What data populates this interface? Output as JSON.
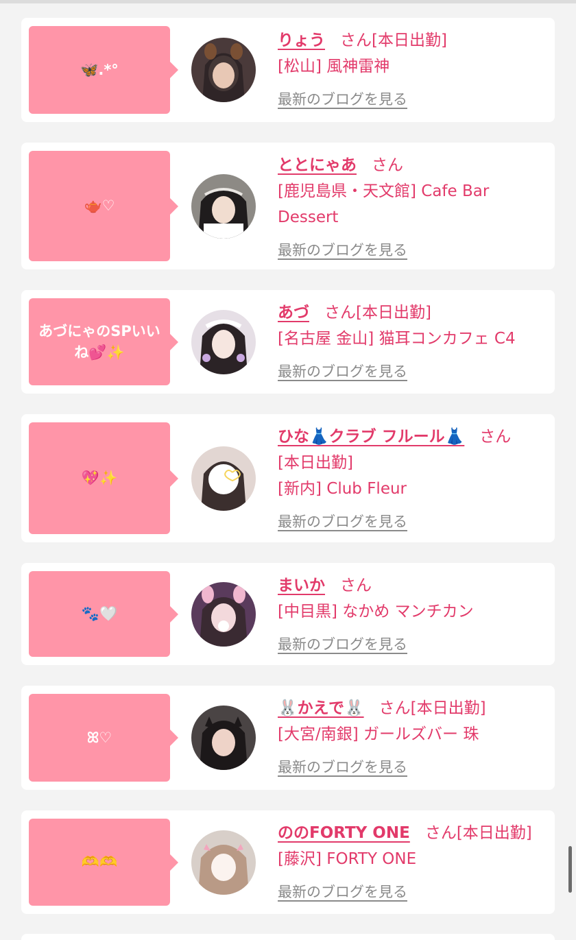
{
  "cards": [
    {
      "bubble": "🦋.*°",
      "name": "りょう",
      "san": "さん",
      "status": "[本日出勤]",
      "shop": "[松山] 風神雷神",
      "blog": "最新のブログを見る"
    },
    {
      "bubble": "🫖♡",
      "name": "ととにゃあ",
      "san": "さん",
      "status": "",
      "shop": "[鹿児島県・天文館] Cafe Bar Dessert",
      "blog": "最新のブログを見る"
    },
    {
      "bubble": "あづにゃのSPいいね💕✨",
      "name": "あづ",
      "san": "さん",
      "status": "[本日出勤]",
      "shop": "[名古屋 金山] 猫耳コンカフェ C4",
      "blog": "最新のブログを見る"
    },
    {
      "bubble": "💖✨",
      "name": "ひな👗クラブ フルール👗",
      "san": "さん",
      "status": "[本日出勤]",
      "shop": "[新内] Club Fleur",
      "blog": "最新のブログを見る"
    },
    {
      "bubble": "🐾🤍",
      "name": "まいか",
      "san": "さん",
      "status": "",
      "shop": "[中目黒] なかめ マンチカン",
      "blog": "最新のブログを見る"
    },
    {
      "bubble": "ꕤ♡",
      "name": "🐰かえで🐰",
      "san": "さん",
      "status": "[本日出勤]",
      "shop": "[大宮/南銀] ガールズバー 珠",
      "blog": "最新のブログを見る"
    },
    {
      "bubble": "🫶🫶",
      "name": "ののFORTY ONE",
      "san": "さん",
      "status": "[本日出勤]",
      "shop": "[藤沢] FORTY ONE",
      "blog": "最新のブログを見る"
    }
  ],
  "colors": {
    "accent": "#e23a6a",
    "bubble": "#ff95a8",
    "link_gray": "#8a8a8a"
  }
}
